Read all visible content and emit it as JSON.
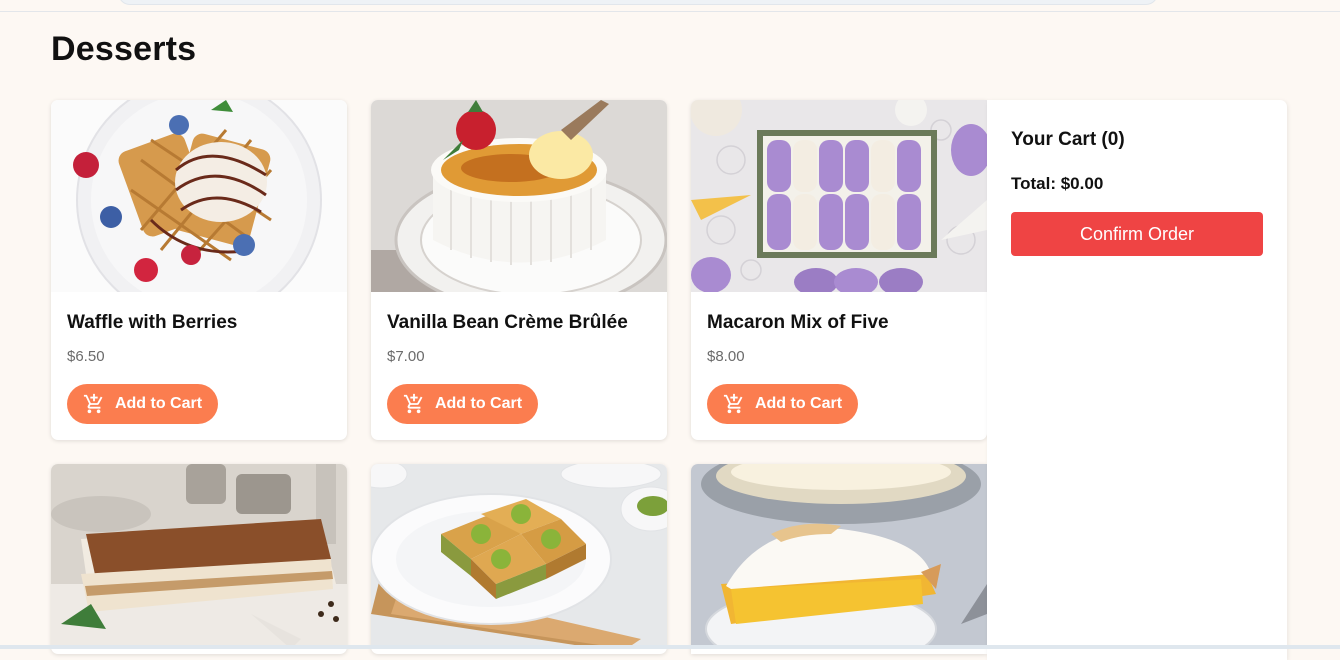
{
  "page": {
    "title": "Desserts"
  },
  "products": [
    {
      "name": "Waffle with Berries",
      "price": "$6.50",
      "add_label": "Add to Cart",
      "image": "waffle-with-berries"
    },
    {
      "name": "Vanilla Bean Crème Brûlée",
      "price": "$7.00",
      "add_label": "Add to Cart",
      "image": "creme-brulee"
    },
    {
      "name": "Macaron Mix of Five",
      "price": "$8.00",
      "add_label": "Add to Cart",
      "image": "macarons"
    },
    {
      "image": "tiramisu"
    },
    {
      "image": "baklava"
    },
    {
      "image": "lemon-meringue-pie"
    }
  ],
  "cart": {
    "title": "Your Cart (0)",
    "total": "Total: $0.00",
    "confirm_label": "Confirm Order"
  },
  "colors": {
    "page_background": "#fdf8f3",
    "add_button": "#fb7d4f",
    "confirm_button": "#ef4444",
    "price_text": "#6b6b6b"
  },
  "icons": {
    "add_to_cart": "add-shopping-cart-icon"
  }
}
